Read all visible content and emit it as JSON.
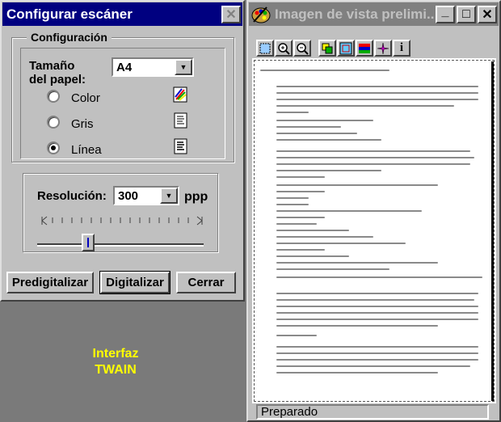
{
  "scanner_dialog": {
    "title": "Configurar escáner",
    "close_glyph": "✕",
    "group_title": "Configuración",
    "paper_size_label_1": "Tamaño",
    "paper_size_label_2": "del papel:",
    "paper_size_value": "A4",
    "modes": [
      {
        "label": "Color",
        "selected": false,
        "icon": "color-palette-icon"
      },
      {
        "label": "Gris",
        "selected": false,
        "icon": "gray-document-icon"
      },
      {
        "label": "Línea",
        "selected": true,
        "icon": "lineart-document-icon"
      }
    ],
    "resolution_label": "Resolución:",
    "resolution_value": "300",
    "resolution_unit": "ppp",
    "slider_level": 0.27,
    "buttons": {
      "prescan": "Predigitalizar",
      "scan": "Digitalizar",
      "close": "Cerrar"
    }
  },
  "background_label": {
    "line1": "Interfaz",
    "line2": "TWAIN"
  },
  "preview_window": {
    "title": "Imagen de vista prelimi...",
    "minimize_glyph": "_",
    "maximize_glyph": "□",
    "close_glyph": "✕",
    "toolbar": [
      {
        "name": "select-area-icon"
      },
      {
        "name": "zoom-in-icon"
      },
      {
        "name": "zoom-out-icon"
      },
      {
        "name": "adjust-colors-icon"
      },
      {
        "name": "crop-icon"
      },
      {
        "name": "palette-icon"
      },
      {
        "name": "sharpen-icon"
      },
      {
        "name": "info-icon",
        "glyph": "i"
      }
    ],
    "status": "Preparado"
  },
  "colors": {
    "active_title": "#000080",
    "inactive_title": "#808080",
    "face": "#c0c0c0",
    "desktop": "#7a7a7a",
    "twain_text": "#ffff00"
  }
}
